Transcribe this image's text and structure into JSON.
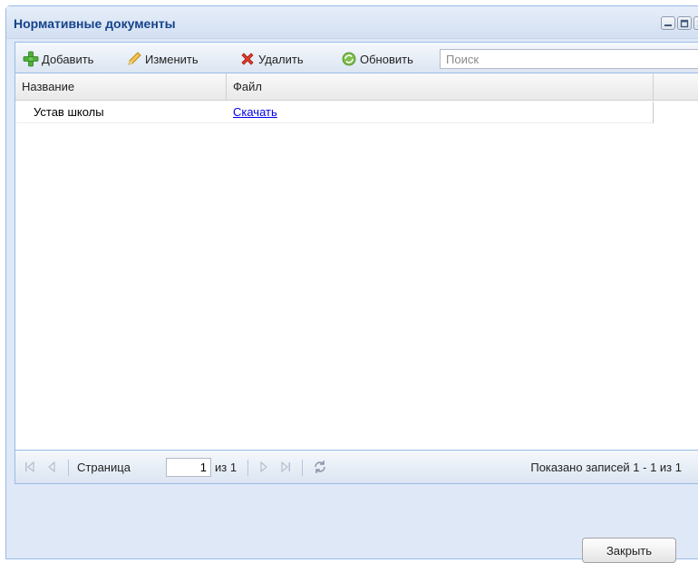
{
  "window": {
    "title": "Нормативные документы"
  },
  "toolbar": {
    "add_label": "Добавить",
    "edit_label": "Изменить",
    "delete_label": "Удалить",
    "refresh_label": "Обновить",
    "search_placeholder": "Поиск"
  },
  "grid": {
    "columns": [
      "Название",
      "Файл"
    ],
    "rows": [
      {
        "name": "Устав школы",
        "file": "Скачать"
      }
    ]
  },
  "pager": {
    "page_label": "Страница",
    "page_value": "1",
    "of_label": "из 1",
    "summary": "Показано записей 1 - 1 из 1"
  },
  "footer": {
    "close_label": "Закрыть"
  },
  "colors": {
    "accent": "#15428b",
    "frame": "#dfe8f6",
    "border": "#99bbe8",
    "link": "#0000ee"
  },
  "icons": [
    "minimize-icon",
    "maximize-icon",
    "close-icon",
    "add-icon",
    "edit-pencil-icon",
    "delete-icon",
    "refresh-icon",
    "first-page-icon",
    "prev-page-icon",
    "next-page-icon",
    "last-page-icon",
    "reload-icon"
  ]
}
